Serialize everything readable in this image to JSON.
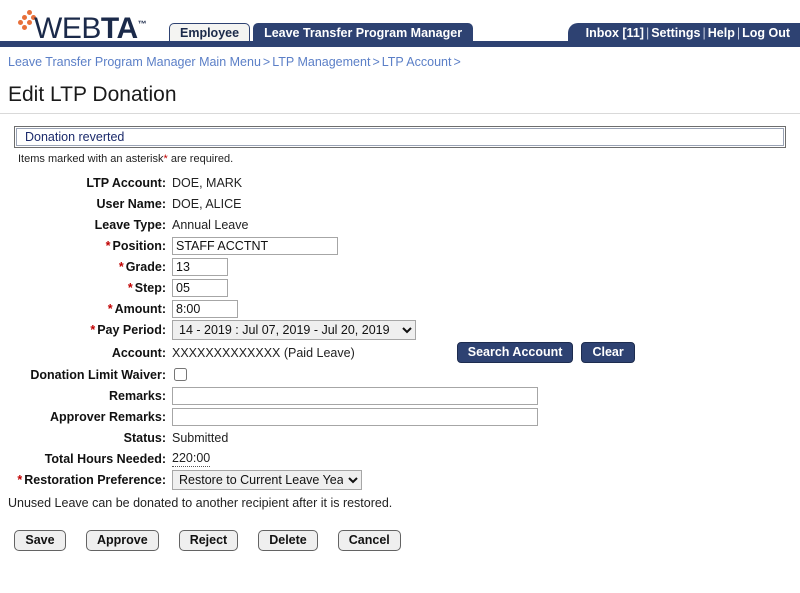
{
  "brand": {
    "logo_web": "WEB",
    "logo_ta": "TA",
    "logo_tm": "™"
  },
  "header": {
    "tabs": [
      {
        "label": "Employee",
        "active": false
      },
      {
        "label": "Leave Transfer Program Manager",
        "active": true
      }
    ],
    "utility": {
      "inbox": "Inbox [11]",
      "settings": "Settings",
      "help": "Help",
      "logout": "Log Out",
      "separator": "|"
    }
  },
  "breadcrumb": {
    "items": [
      "Leave Transfer Program Manager Main Menu",
      "LTP Management",
      "LTP Account"
    ],
    "separator": ">",
    "trailing": ">"
  },
  "page": {
    "title": "Edit LTP Donation",
    "message": "Donation reverted",
    "asterisk_note_pre": "Items marked with an asterisk",
    "asterisk_note_star": "*",
    "asterisk_note_post": " are required.",
    "hint": "Unused Leave can be donated to another recipient after it is restored."
  },
  "form": {
    "ltp_account": {
      "label": "LTP Account:",
      "value": "DOE, MARK"
    },
    "user_name": {
      "label": "User Name:",
      "value": "DOE, ALICE"
    },
    "leave_type": {
      "label": "Leave Type:",
      "value": "Annual Leave"
    },
    "position": {
      "label": "Position:",
      "value": "STAFF ACCTNT",
      "required": true
    },
    "grade": {
      "label": "Grade:",
      "value": "13",
      "required": true
    },
    "step": {
      "label": "Step:",
      "value": "05",
      "required": true
    },
    "amount": {
      "label": "Amount:",
      "value": "8:00",
      "required": true
    },
    "pay_period": {
      "label": "Pay Period:",
      "value": "14 - 2019 : Jul 07, 2019 - Jul 20, 2019",
      "required": true,
      "options": [
        "14 - 2019 : Jul 07, 2019 - Jul 20, 2019"
      ]
    },
    "account": {
      "label": "Account:",
      "value": "XXXXXXXXXXXXX (Paid Leave)",
      "search_button": "Search Account",
      "clear_button": "Clear"
    },
    "donation_limit_waiver": {
      "label": "Donation Limit Waiver:",
      "checked": false
    },
    "remarks": {
      "label": "Remarks:",
      "value": "",
      "placeholder": ""
    },
    "approver_remarks": {
      "label": "Approver Remarks:",
      "value": "",
      "placeholder": ""
    },
    "status": {
      "label": "Status:",
      "value": "Submitted"
    },
    "total_hours_needed": {
      "label": "Total Hours Needed:",
      "value": "220:00"
    },
    "restoration_preference": {
      "label": "Restoration Preference:",
      "value": "Restore to Current Leave Year",
      "required": true,
      "options": [
        "Restore to Current Leave Year"
      ]
    },
    "required_marker": "*"
  },
  "actions": {
    "save": "Save",
    "approve": "Approve",
    "reject": "Reject",
    "delete": "Delete",
    "cancel": "Cancel"
  },
  "colors": {
    "brand_navy": "#2e4272",
    "accent_orange": "#e8703a",
    "link_blue": "#5b7fc7",
    "required_red": "#c00000",
    "message_blue": "#1b2a6b"
  }
}
